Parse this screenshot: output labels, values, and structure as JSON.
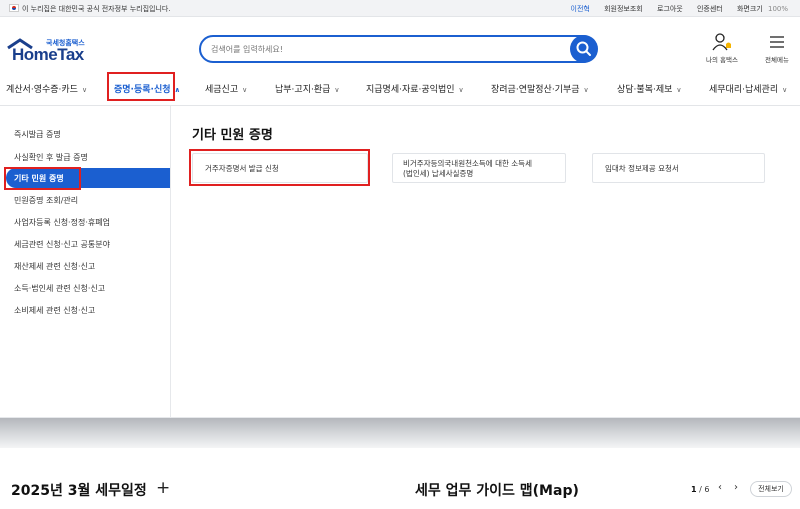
{
  "topbar": {
    "notice": "이 누리집은 대한민국 공식 전자정부 누리집입니다.",
    "links": [
      "이전혁",
      "회원정보조회",
      "로그아웃",
      "인증센터",
      "화면크기"
    ],
    "zoom": "100%"
  },
  "header": {
    "logo_sub": "국세청홈택스",
    "logo_main": "HomeTax",
    "search_placeholder": "검색어를 입력하세요!",
    "my_hometax": "나의 홈택스",
    "all_menu": "전체메뉴"
  },
  "mainnav": {
    "items": [
      "계산서·영수증·카드",
      "증명·등록·신청",
      "세금신고",
      "납부·고지·환급",
      "지급명세·자료·공익법인",
      "장려금·연말정산·기부금",
      "상담·불복·제보",
      "세무대리·납세관리"
    ]
  },
  "leftnav": {
    "items": [
      "즉시발급 증명",
      "사실확인 후 발급 증명",
      "기타 민원 증명",
      "민원증명 조회/관리",
      "사업자등록 신청·정정·휴폐업",
      "세금관련 신청·신고 공통분야",
      "재산제세 관련 신청·신고",
      "소득·법인세 관련 신청·신고",
      "소비제세 관련 신청·신고"
    ]
  },
  "content": {
    "title": "기타 민원 증명",
    "cards": [
      "거주자증명서 발급 신청",
      "비거주자등의국내원천소득에 대한 소득세",
      "(법인세) 납세사실증명",
      "임대차 정보제공 요청서"
    ]
  },
  "below": {
    "schedule_title": "2025년 3월 세무일정",
    "plus": "+",
    "guide_title": "세무 업무 가이드 맵(Map)",
    "page_current": "1",
    "page_total": "/ 6",
    "view_all": "전체보기"
  }
}
